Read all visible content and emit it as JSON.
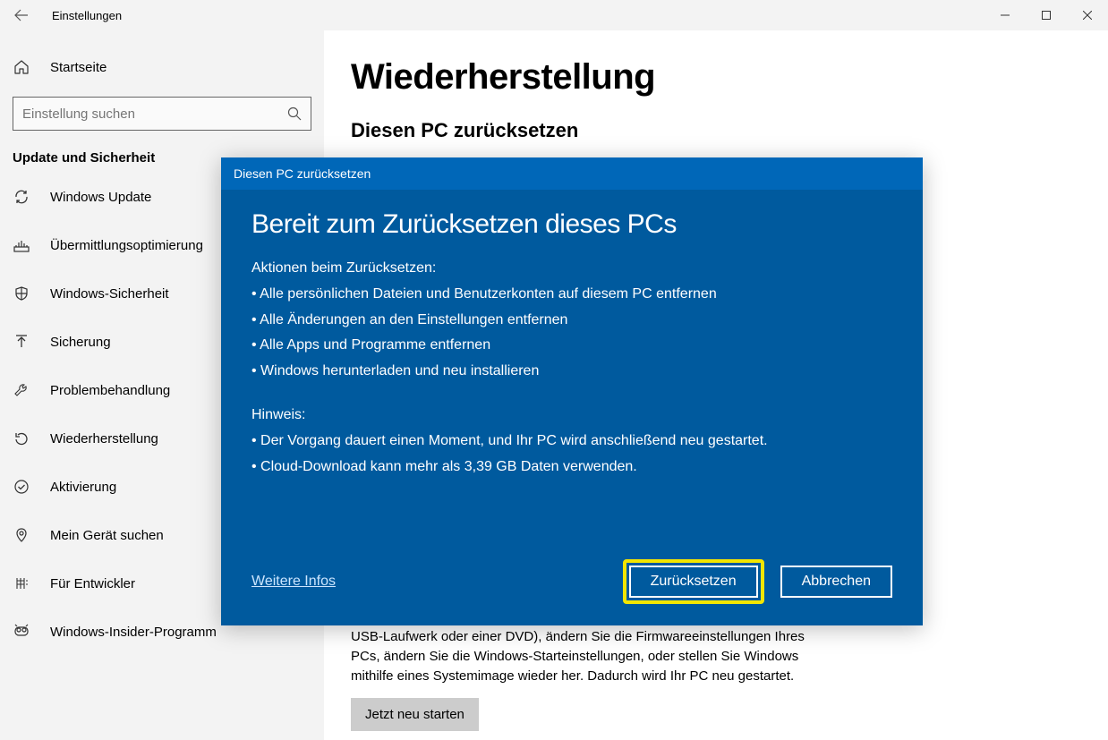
{
  "window": {
    "title": "Einstellungen"
  },
  "sidebar": {
    "home": "Startseite",
    "search_placeholder": "Einstellung suchen",
    "section": "Update und Sicherheit",
    "items": [
      {
        "label": "Windows Update"
      },
      {
        "label": "Übermittlungsoptimierung"
      },
      {
        "label": "Windows-Sicherheit"
      },
      {
        "label": "Sicherung"
      },
      {
        "label": "Problembehandlung"
      },
      {
        "label": "Wiederherstellung"
      },
      {
        "label": "Aktivierung"
      },
      {
        "label": "Mein Gerät suchen"
      },
      {
        "label": "Für Entwickler"
      },
      {
        "label": "Windows-Insider-Programm"
      }
    ]
  },
  "main": {
    "heading": "Wiederherstellung",
    "subheading": "Diesen PC zurücksetzen",
    "visible_body": "USB-Laufwerk oder einer DVD), ändern Sie die Firmwareeinstellungen Ihres PCs, ändern Sie die Windows-Starteinstellungen, oder stellen Sie Windows mithilfe eines Systemimage wieder her. Dadurch wird Ihr PC neu gestartet.",
    "restart_btn": "Jetzt neu starten"
  },
  "dialog": {
    "titlebar": "Diesen PC zurücksetzen",
    "title": "Bereit zum Zurücksetzen dieses PCs",
    "actions_head": "Aktionen beim Zurücksetzen:",
    "b1": "• Alle persönlichen Dateien und Benutzerkonten auf diesem PC entfernen",
    "b2": "• Alle Änderungen an den Einstellungen entfernen",
    "b3": "• Alle Apps und Programme entfernen",
    "b4": "•  Windows herunterladen und neu installieren",
    "note_head": "Hinweis:",
    "n1": "•  Der Vorgang dauert einen Moment, und Ihr PC wird anschließend neu gestartet.",
    "n2": "•  Cloud-Download kann mehr als 3,39 GB Daten verwenden.",
    "more_info": "Weitere Infos",
    "reset_btn": "Zurücksetzen",
    "cancel_btn": "Abbrechen"
  }
}
